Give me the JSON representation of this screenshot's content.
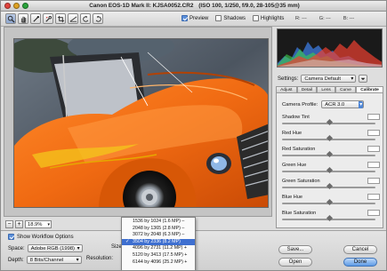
{
  "window": {
    "title": "Canon EOS-1D Mark II: KJSA0052.CR2",
    "exif": "(ISO 100, 1/250, f/9.0, 28-105@35 mm)"
  },
  "toolbar": {
    "tools": [
      {
        "icon": "zoom-icon"
      },
      {
        "icon": "hand-icon"
      },
      {
        "icon": "white-balance-icon"
      },
      {
        "icon": "color-sampler-icon"
      },
      {
        "icon": "crop-icon"
      },
      {
        "icon": "straighten-icon"
      },
      {
        "icon": "rotate-left-icon"
      },
      {
        "icon": "rotate-right-icon"
      }
    ],
    "preview_label": "Preview",
    "preview_checked": true,
    "shadows_label": "Shadows",
    "shadows_checked": false,
    "highlights_label": "Highlights",
    "highlights_checked": false,
    "rgb": {
      "r": "R: ---",
      "g": "G: ---",
      "b": "B: ---"
    }
  },
  "zoom": {
    "minus": "−",
    "plus": "+",
    "value": "18.9%"
  },
  "panel": {
    "settings_label": "Settings:",
    "settings_value": "Camera Default",
    "tabs": [
      "Adjust",
      "Detail",
      "Lens",
      "Curve",
      "Calibrate"
    ],
    "active_tab": "Calibrate",
    "camera_profile_label": "Camera Profile:",
    "camera_profile_value": "ACR 3.0",
    "sliders": [
      {
        "label": "Shadow Tint",
        "value": 0.5
      },
      {
        "label": "Red Hue",
        "value": 0.5
      },
      {
        "label": "Red Saturation",
        "value": 0.5
      },
      {
        "label": "Green Hue",
        "value": 0.5
      },
      {
        "label": "Green Saturation",
        "value": 0.5
      },
      {
        "label": "Blue Hue",
        "value": 0.5
      },
      {
        "label": "Blue Saturation",
        "value": 0.5
      }
    ]
  },
  "workflow": {
    "show_label": "Show Workflow Options",
    "show_checked": true,
    "space_label": "Space:",
    "space_value": "Adobe RGB (1998)",
    "depth_label": "Depth:",
    "depth_value": "8 Bits/Channel",
    "size_label": "Size:",
    "resolution_label": "Resolution:"
  },
  "size_menu": {
    "items": [
      "1536 by 1024 (1.6 MP) –",
      "2048 by 1365 (2.8 MP) –",
      "3072 by 2048 (6.3 MP) –",
      "3504 by 2336 (8.2 MP)",
      "4096 by 2731 (11.2 MP) +",
      "5120 by 3413 (17.5 MP) +",
      "6144 by 4096 (25.2 MP) +"
    ],
    "selected_index": 3,
    "check": "✓"
  },
  "buttons": {
    "save": "Save...",
    "cancel": "Cancel",
    "open": "Open",
    "done": "Done"
  },
  "colors": {
    "car_orange": "#f06a12",
    "selection_blue": "#3e6fd0",
    "default_button": "#5e9be6"
  }
}
